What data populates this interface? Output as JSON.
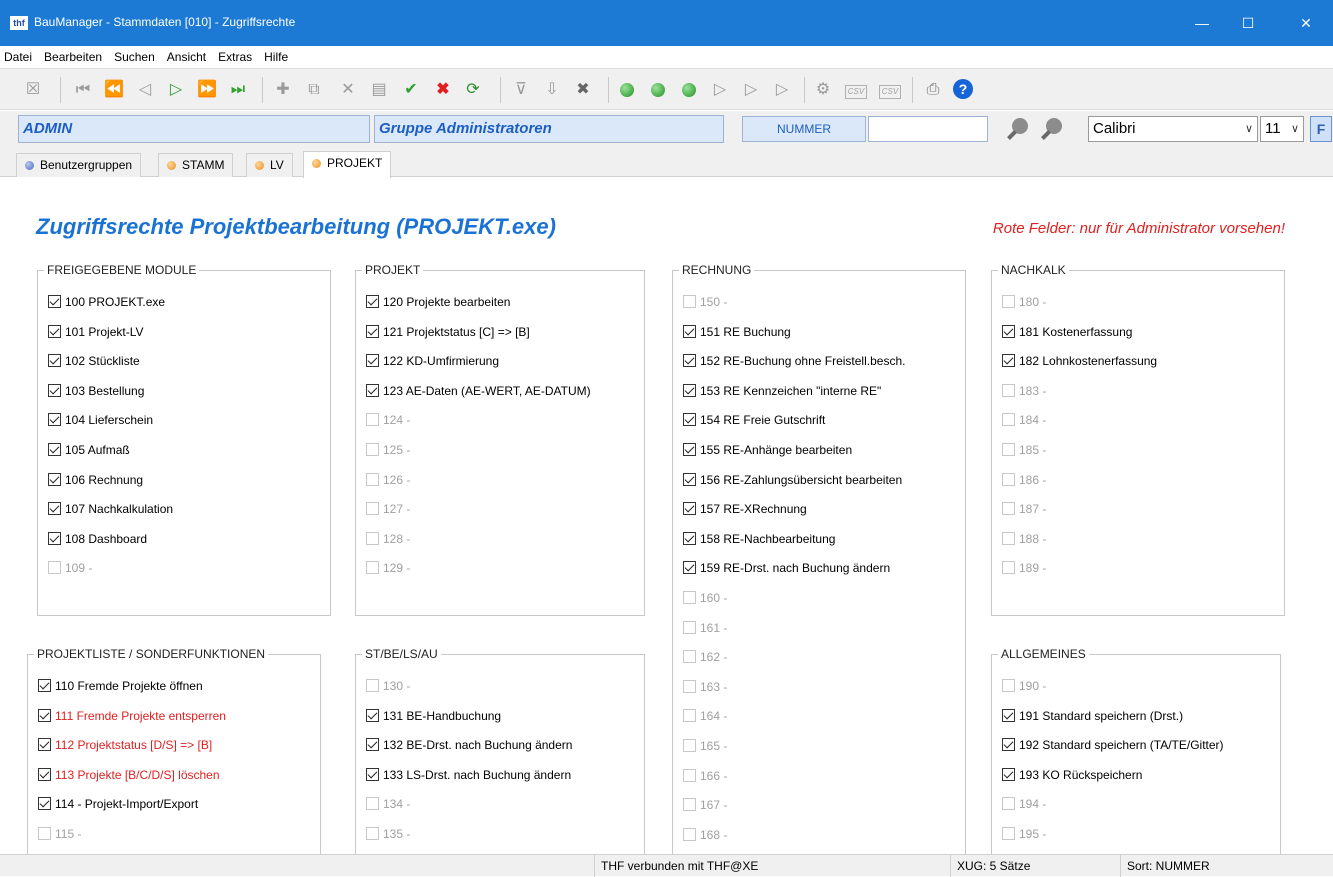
{
  "window": {
    "icon_text": "thf",
    "title": "BauManager - Stammdaten [010] - Zugriffsrechte",
    "minimize": "—",
    "maximize": "☐",
    "close": "✕"
  },
  "menu": [
    "Datei",
    "Bearbeiten",
    "Suchen",
    "Ansicht",
    "Extras",
    "Hilfe"
  ],
  "toolbar": {
    "csv1": "CSV",
    "csv2": "CSV",
    "help": "?"
  },
  "header": {
    "user": "ADMIN",
    "group": "Gruppe Administratoren",
    "search_label": "NUMMER",
    "search_value": "",
    "font": "Calibri",
    "font_size": "11",
    "format_button": "F"
  },
  "tabs": [
    {
      "label": "Benutzergruppen",
      "dot": "blue"
    },
    {
      "label": "STAMM",
      "dot": "orange"
    },
    {
      "label": "LV",
      "dot": "orange"
    },
    {
      "label": "PROJEKT",
      "dot": "orange",
      "active": true
    }
  ],
  "content": {
    "title": "Zugriffsrechte Projektbearbeitung (PROJEKT.exe)",
    "note": "Rote Felder:  nur für Administrator vorsehen!",
    "groups": [
      {
        "title": "FREIGEGEBENE MODULE",
        "items": [
          {
            "label": "100 PROJEKT.exe",
            "checked": true
          },
          {
            "label": "101 Projekt-LV",
            "checked": true
          },
          {
            "label": "102 Stückliste",
            "checked": true
          },
          {
            "label": "103 Bestellung",
            "checked": true
          },
          {
            "label": "104 Lieferschein",
            "checked": true
          },
          {
            "label": "105 Aufmaß",
            "checked": true
          },
          {
            "label": "106 Rechnung",
            "checked": true
          },
          {
            "label": "107 Nachkalkulation",
            "checked": true
          },
          {
            "label": "108 Dashboard",
            "checked": true
          },
          {
            "label": "109 -",
            "checked": false,
            "disabled": true
          }
        ]
      },
      {
        "title": "PROJEKT",
        "items": [
          {
            "label": "120 Projekte bearbeiten",
            "checked": true
          },
          {
            "label": "121 Projektstatus [C] => [B]",
            "checked": true
          },
          {
            "label": "122 KD-Umfirmierung",
            "checked": true
          },
          {
            "label": "123 AE-Daten (AE-WERT, AE-DATUM)",
            "checked": true
          },
          {
            "label": "124 -",
            "checked": false,
            "disabled": true
          },
          {
            "label": "125 -",
            "checked": false,
            "disabled": true
          },
          {
            "label": "126 -",
            "checked": false,
            "disabled": true
          },
          {
            "label": "127 -",
            "checked": false,
            "disabled": true
          },
          {
            "label": "128 -",
            "checked": false,
            "disabled": true
          },
          {
            "label": "129 -",
            "checked": false,
            "disabled": true
          }
        ]
      },
      {
        "title": "RECHNUNG",
        "items": [
          {
            "label": "150 -",
            "checked": false,
            "disabled": true
          },
          {
            "label": "151 RE Buchung",
            "checked": true
          },
          {
            "label": "152 RE-Buchung ohne Freistell.besch.",
            "checked": true
          },
          {
            "label": "153 RE Kennzeichen \"interne RE\"",
            "checked": true
          },
          {
            "label": "154 RE Freie Gutschrift",
            "checked": true
          },
          {
            "label": "155 RE-Anhänge bearbeiten",
            "checked": true
          },
          {
            "label": "156 RE-Zahlungsübersicht bearbeiten",
            "checked": true
          },
          {
            "label": "157 RE-XRechnung",
            "checked": true
          },
          {
            "label": "158 RE-Nachbearbeitung",
            "checked": true
          },
          {
            "label": "159 RE-Drst. nach Buchung ändern",
            "checked": true
          },
          {
            "label": "160 -",
            "checked": false,
            "disabled": true
          },
          {
            "label": "161 -",
            "checked": false,
            "disabled": true
          },
          {
            "label": "162 -",
            "checked": false,
            "disabled": true
          },
          {
            "label": "163 -",
            "checked": false,
            "disabled": true
          },
          {
            "label": "164 -",
            "checked": false,
            "disabled": true
          },
          {
            "label": "165 -",
            "checked": false,
            "disabled": true
          },
          {
            "label": "166 -",
            "checked": false,
            "disabled": true
          },
          {
            "label": "167 -",
            "checked": false,
            "disabled": true
          },
          {
            "label": "168 -",
            "checked": false,
            "disabled": true
          }
        ]
      },
      {
        "title": "NACHKALK",
        "items": [
          {
            "label": "180 -",
            "checked": false,
            "disabled": true
          },
          {
            "label": "181 Kostenerfassung",
            "checked": true
          },
          {
            "label": "182 Lohnkostenerfassung",
            "checked": true
          },
          {
            "label": "183 -",
            "checked": false,
            "disabled": true
          },
          {
            "label": "184 -",
            "checked": false,
            "disabled": true
          },
          {
            "label": "185 -",
            "checked": false,
            "disabled": true
          },
          {
            "label": "186 -",
            "checked": false,
            "disabled": true
          },
          {
            "label": "187 -",
            "checked": false,
            "disabled": true
          },
          {
            "label": "188 -",
            "checked": false,
            "disabled": true
          },
          {
            "label": "189 -",
            "checked": false,
            "disabled": true
          }
        ]
      },
      {
        "title": "PROJEKTLISTE / SONDERFUNKTIONEN",
        "items": [
          {
            "label": "110 Fremde Projekte öffnen",
            "checked": true
          },
          {
            "label": "111 Fremde Projekte entsperren",
            "checked": true,
            "red": true
          },
          {
            "label": "112 Projektstatus [D/S] => [B]",
            "checked": true,
            "red": true
          },
          {
            "label": "113 Projekte [B/C/D/S] löschen",
            "checked": true,
            "red": true
          },
          {
            "label": "114 - Projekt-Import/Export",
            "checked": true
          },
          {
            "label": "115 -",
            "checked": false,
            "disabled": true
          }
        ]
      },
      {
        "title": "ST/BE/LS/AU",
        "items": [
          {
            "label": "130 -",
            "checked": false,
            "disabled": true
          },
          {
            "label": "131 BE-Handbuchung",
            "checked": true
          },
          {
            "label": "132 BE-Drst. nach Buchung ändern",
            "checked": true
          },
          {
            "label": "133 LS-Drst. nach Buchung ändern",
            "checked": true
          },
          {
            "label": "134 -",
            "checked": false,
            "disabled": true
          },
          {
            "label": "135 -",
            "checked": false,
            "disabled": true
          }
        ]
      },
      {
        "title": "ALLGEMEINES",
        "items": [
          {
            "label": "190 -",
            "checked": false,
            "disabled": true
          },
          {
            "label": "191 Standard speichern (Drst.)",
            "checked": true
          },
          {
            "label": "192 Standard speichern (TA/TE/Gitter)",
            "checked": true
          },
          {
            "label": "193 KO Rückspeichern",
            "checked": true
          },
          {
            "label": "194 -",
            "checked": false,
            "disabled": true
          },
          {
            "label": "195 -",
            "checked": false,
            "disabled": true
          }
        ]
      }
    ]
  },
  "status": {
    "connection": "THF verbunden mit THF@XE",
    "records": "XUG: 5 Sätze",
    "sort": "Sort: NUMMER"
  }
}
